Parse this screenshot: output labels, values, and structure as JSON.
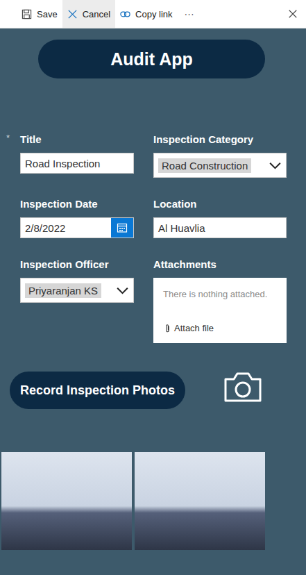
{
  "toolbar": {
    "actions": [
      {
        "label": "Save",
        "icon": "save",
        "highlighted": false
      },
      {
        "label": "Cancel",
        "icon": "cancel",
        "highlighted": true
      },
      {
        "label": "Copy link",
        "icon": "link",
        "highlighted": false
      }
    ],
    "more": "···"
  },
  "header": {
    "title": "Audit App"
  },
  "form": {
    "required_mark": "*",
    "fields": [
      {
        "label": "Title",
        "kind": "text",
        "value": "Road Inspection",
        "required": true
      },
      {
        "label": "Inspection Category",
        "kind": "dropdown",
        "value": "Road Construction",
        "required": false
      },
      {
        "label": "Inspection Date",
        "kind": "date",
        "value": "2/8/2022",
        "required": false
      },
      {
        "label": "Location",
        "kind": "text",
        "value": "Al Huavlia",
        "required": false
      },
      {
        "label": "Inspection Officer",
        "kind": "dropdown",
        "value": "Priyaranjan KS",
        "required": false
      },
      {
        "label": "Attachments",
        "kind": "attachments",
        "value": "There is nothing attached.",
        "action": "Attach file",
        "required": false
      }
    ]
  },
  "photos_button": "Record Inspection Photos",
  "photos": [
    {
      "kind": "photo"
    },
    {
      "kind": "photo"
    }
  ]
}
